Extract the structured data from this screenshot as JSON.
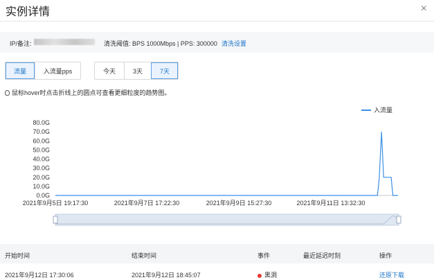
{
  "dialog": {
    "title": "实例详情",
    "close_glyph": "×"
  },
  "info_bar": {
    "ip_label": "IP/备注:",
    "threshold": "清洗阈值: BPS 1000Mbps | PPS: 300000",
    "settings_link": "清洗设置"
  },
  "metric_tabs": [
    {
      "label": "流量",
      "active": true
    },
    {
      "label": "入流量pps",
      "active": false
    }
  ],
  "range_tabs": [
    {
      "label": "今天",
      "active": false
    },
    {
      "label": "3天",
      "active": false
    },
    {
      "label": "7天",
      "active": true
    }
  ],
  "hint": "鼠标hover时点击折线上的圆点可查看更细粒度的趋势图。",
  "chart_data": {
    "type": "line",
    "legend": [
      "入流量"
    ],
    "y_ticks": [
      "0.0G",
      "10.0G",
      "20.0G",
      "30.0G",
      "40.0G",
      "50.0G",
      "60.0G",
      "70.0G",
      "80.0G"
    ],
    "ylim": [
      0,
      80
    ],
    "x_ticks": [
      "2021年9月5日 19:17:30",
      "2021年9月7日 17:22:30",
      "2021年9月9日 15:27:30",
      "2021年9月11日 13:32:30"
    ],
    "series": [
      {
        "name": "入流量",
        "values": [
          [
            0,
            0
          ],
          [
            0.94,
            0
          ],
          [
            0.945,
            18
          ],
          [
            0.952,
            70
          ],
          [
            0.958,
            20
          ],
          [
            0.98,
            20
          ],
          [
            0.985,
            0
          ],
          [
            1,
            0
          ]
        ]
      }
    ],
    "line_color": "#3a8ee6",
    "grid": false,
    "legend_position": "top-right"
  },
  "table": {
    "headers": [
      "开始时间",
      "结束时间",
      "事件",
      "最近延迟时刻",
      "操作"
    ],
    "rows": [
      {
        "start": "2021年9月12日 17:30:06",
        "end": "2021年9月12日 18:45:07",
        "event": "黑洞",
        "delay": "",
        "action": "还原下载"
      }
    ]
  }
}
